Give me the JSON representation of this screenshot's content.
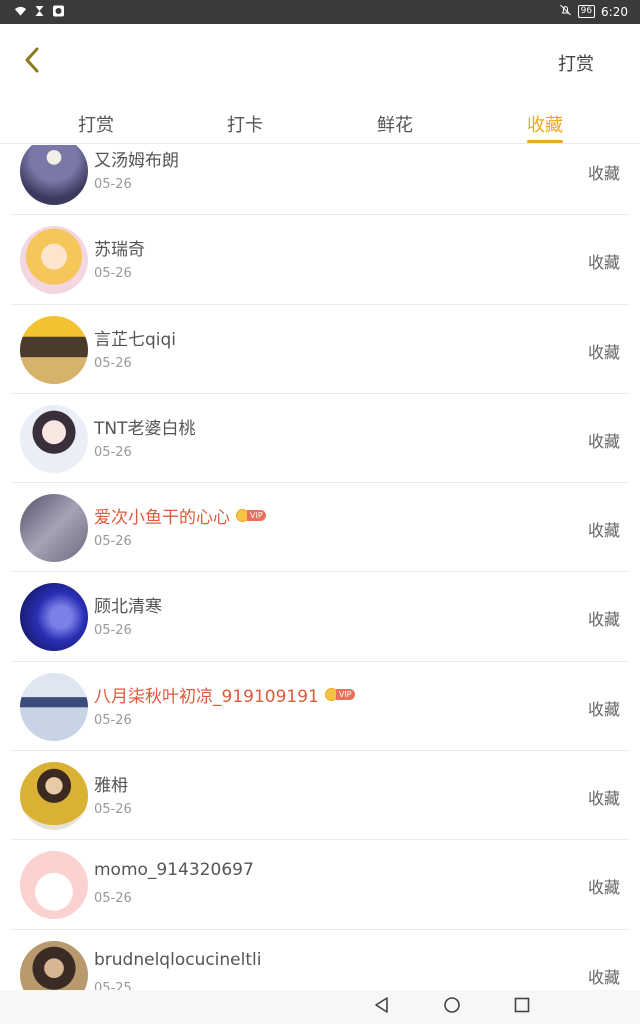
{
  "status_bar": {
    "time": "6:20",
    "battery": "96",
    "icons": [
      "wifi-icon",
      "hourglass-icon",
      "app-notification-icon",
      "mute-icon"
    ]
  },
  "header": {
    "back_icon": "chevron-left-icon",
    "action_label": "打赏"
  },
  "tabs": [
    {
      "label": "打赏",
      "active": false
    },
    {
      "label": "打卡",
      "active": false
    },
    {
      "label": "鲜花",
      "active": false
    },
    {
      "label": "收藏",
      "active": true
    }
  ],
  "colors": {
    "accent": "#f0a81e",
    "vip_name": "#e05a3a",
    "text": "#555555",
    "muted": "#999999"
  },
  "list": [
    {
      "name": "又汤姆布朗",
      "date": "05-26",
      "action": "收藏",
      "vip": false
    },
    {
      "name": "苏瑞奇",
      "date": "05-26",
      "action": "收藏",
      "vip": false
    },
    {
      "name": "言芷七qiqi",
      "date": "05-26",
      "action": "收藏",
      "vip": false
    },
    {
      "name": "TNT老婆白桃",
      "date": "05-26",
      "action": "收藏",
      "vip": false
    },
    {
      "name": "爱次小鱼干的心心",
      "date": "05-26",
      "action": "收藏",
      "vip": true,
      "vip_label": "VIP"
    },
    {
      "name": "顾北清寒",
      "date": "05-26",
      "action": "收藏",
      "vip": false
    },
    {
      "name": "八月柒秋叶初凉_919109191",
      "date": "05-26",
      "action": "收藏",
      "vip": true,
      "vip_label": "VIP"
    },
    {
      "name": "雅枏",
      "date": "05-26",
      "action": "收藏",
      "vip": false
    },
    {
      "name": "momo_914320697",
      "date": "05-26",
      "action": "收藏",
      "vip": false
    },
    {
      "name": "brudnelqlocucineltli",
      "date": "05-25",
      "action": "收藏",
      "vip": false
    }
  ],
  "nav_bar": {
    "icons": [
      "back-triangle-icon",
      "home-circle-icon",
      "recents-square-icon"
    ]
  }
}
